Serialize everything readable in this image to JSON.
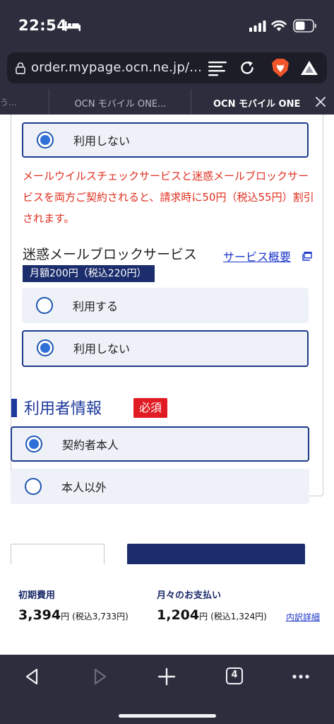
{
  "status_bar": {
    "time": "22:54"
  },
  "browser": {
    "url": "order.mypage.ocn.ne.jp/...",
    "tabs": [
      {
        "label": "う..."
      },
      {
        "label": "OCN モバイル ONE..."
      },
      {
        "label": "OCN モバイル ONE"
      }
    ],
    "tab_count": "4"
  },
  "panel": {
    "option_top": {
      "label": "利用しない",
      "selected": true
    },
    "notice": "メールウイルスチェックサービスと迷惑メールブロックサービスを両方ご契約されると、請求時に50円（税込55円）割引されます。",
    "service": {
      "title": "迷惑メールブロックサービス",
      "link": "サービス概要",
      "price": "月額200円（税込220円）",
      "options": [
        {
          "label": "利用する",
          "selected": false
        },
        {
          "label": "利用しない",
          "selected": true
        }
      ]
    }
  },
  "user_info": {
    "title": "利用者情報",
    "required": "必須",
    "options": [
      {
        "label": "契約者本人",
        "selected": true
      },
      {
        "label": "本人以外",
        "selected": false
      }
    ]
  },
  "summary": {
    "initial": {
      "label": "初期費用",
      "amount": "3,394",
      "unit": "円",
      "tax": "(税込3,733円)"
    },
    "monthly": {
      "label": "月々のお支払い",
      "amount": "1,204",
      "unit": "円",
      "tax": "(税込1,324円)"
    },
    "detail_link": "内訳詳細"
  },
  "colors": {
    "chrome": "#2c2e3d",
    "brand_navy": "#1b2d6c",
    "notice_red": "#e02e1e",
    "required_red": "#e01b23",
    "link_blue": "#1a35c9",
    "option_bg": "#eef1f8"
  }
}
